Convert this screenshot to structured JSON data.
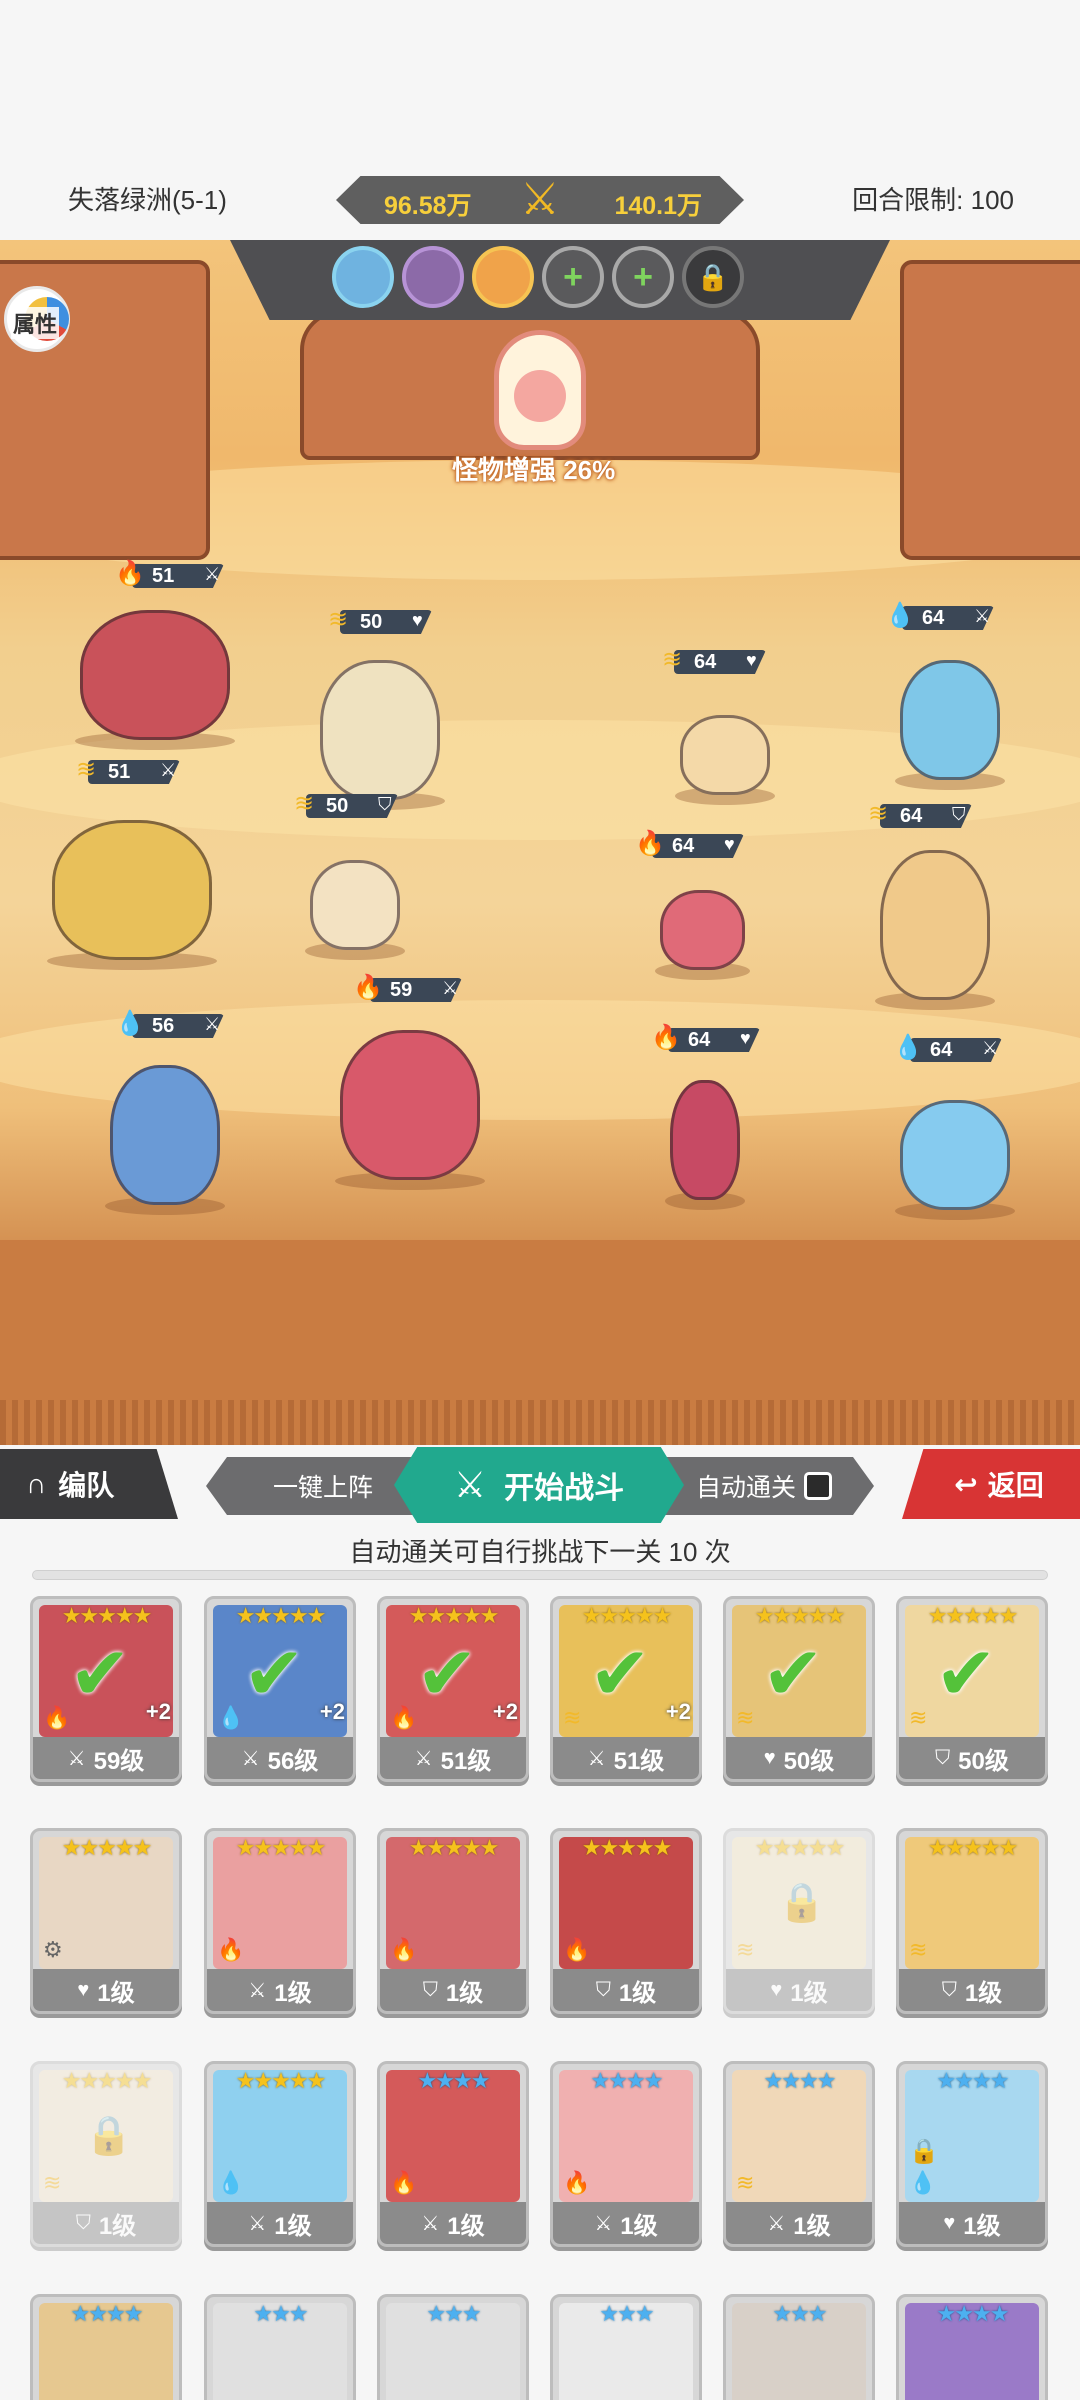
{
  "header": {
    "stage": "失落绿洲(5-1)",
    "power_left": "96.58万",
    "power_right": "140.1万",
    "round_limit": "回合限制: 100"
  },
  "battlefield": {
    "attribute_button": "属性",
    "boss_buff": "怪物增强 26%",
    "team_slots": [
      "hero",
      "hero",
      "hero",
      "add",
      "add",
      "lock"
    ],
    "units": [
      {
        "level": "51",
        "element": "fire",
        "class": "sword"
      },
      {
        "level": "51",
        "element": "wind",
        "class": "sword"
      },
      {
        "level": "50",
        "element": "wind",
        "class": "heart"
      },
      {
        "level": "50",
        "element": "wind",
        "class": "shield"
      },
      {
        "level": "56",
        "element": "water",
        "class": "sword"
      },
      {
        "level": "59",
        "element": "fire",
        "class": "sword"
      },
      {
        "level": "64",
        "element": "wind",
        "class": "heart"
      },
      {
        "level": "64",
        "element": "fire",
        "class": "heart"
      },
      {
        "level": "64",
        "element": "fire",
        "class": "heart"
      },
      {
        "level": "64",
        "element": "water",
        "class": "sword"
      },
      {
        "level": "64",
        "element": "wind",
        "class": "shield"
      },
      {
        "level": "64",
        "element": "water",
        "class": "sword"
      }
    ]
  },
  "actions": {
    "team": "编队",
    "one_key": "一键上阵",
    "start_battle": "开始战斗",
    "auto_clear": "自动通关",
    "back": "返回",
    "auto_hint": "自动通关可自行挑战下一关 10 次"
  },
  "heroes": [
    {
      "level": "59级",
      "stars": "★★★★★",
      "star_color": "gold",
      "element": "fire",
      "class": "sword",
      "selected": true,
      "plus": "+2",
      "art": "#c9525a"
    },
    {
      "level": "56级",
      "stars": "★★★★★",
      "star_color": "gold",
      "element": "water",
      "class": "sword",
      "selected": true,
      "plus": "+2",
      "art": "#5a86c9"
    },
    {
      "level": "51级",
      "stars": "★★★★★",
      "star_color": "gold",
      "element": "fire",
      "class": "sword",
      "selected": true,
      "plus": "+2",
      "art": "#d45a5a"
    },
    {
      "level": "51级",
      "stars": "★★★★★",
      "star_color": "gold",
      "element": "wind",
      "class": "sword",
      "selected": true,
      "plus": "+2",
      "art": "#e8c05a"
    },
    {
      "level": "50级",
      "stars": "★★★★★",
      "star_color": "gold",
      "element": "wind",
      "class": "heart",
      "selected": true,
      "plus": "",
      "art": "#e6c478"
    },
    {
      "level": "50级",
      "stars": "★★★★★",
      "star_color": "gold",
      "element": "wind",
      "class": "shield",
      "selected": true,
      "plus": "",
      "art": "#efd7a0"
    },
    {
      "level": "1级",
      "stars": "★★★★★",
      "star_color": "gold",
      "element": "gear",
      "class": "heart",
      "selected": false,
      "plus": "",
      "art": "#e8d7c4"
    },
    {
      "level": "1级",
      "stars": "★★★★★",
      "star_color": "gold",
      "element": "fire",
      "class": "sword",
      "selected": false,
      "plus": "",
      "art": "#eaa0a0"
    },
    {
      "level": "1级",
      "stars": "★★★★★",
      "star_color": "gold",
      "element": "fire",
      "class": "shield",
      "selected": false,
      "plus": "",
      "art": "#d4696c"
    },
    {
      "level": "1级",
      "stars": "★★★★★",
      "star_color": "gold",
      "element": "fire",
      "class": "shield",
      "selected": false,
      "plus": "",
      "art": "#c54a4a"
    },
    {
      "level": "1级",
      "stars": "★★★★★",
      "star_color": "gold",
      "element": "wind",
      "class": "heart",
      "selected": false,
      "plus": "",
      "art": "#efe0c0",
      "locked": true
    },
    {
      "level": "1级",
      "stars": "★★★★★",
      "star_color": "gold",
      "element": "wind",
      "class": "shield",
      "selected": false,
      "plus": "",
      "art": "#efc97a"
    },
    {
      "level": "1级",
      "stars": "★★★★★",
      "star_color": "gold",
      "element": "wind",
      "class": "shield",
      "selected": false,
      "plus": "",
      "art": "#efe0c8",
      "locked": true
    },
    {
      "level": "1级",
      "stars": "★★★★★",
      "star_color": "gold",
      "element": "water",
      "class": "sword",
      "selected": false,
      "plus": "",
      "art": "#8fd0ef"
    },
    {
      "level": "1级",
      "stars": "★★★★",
      "star_color": "blue",
      "element": "fire",
      "class": "sword",
      "selected": false,
      "plus": "",
      "art": "#d45a5a"
    },
    {
      "level": "1级",
      "stars": "★★★★",
      "star_color": "blue",
      "element": "fire",
      "class": "sword",
      "selected": false,
      "plus": "",
      "art": "#f0b0b0"
    },
    {
      "level": "1级",
      "stars": "★★★★",
      "star_color": "blue",
      "element": "wind",
      "class": "sword",
      "selected": false,
      "plus": "",
      "art": "#f0d8b8"
    },
    {
      "level": "1级",
      "stars": "★★★★",
      "star_color": "blue",
      "element": "water",
      "class": "heart",
      "selected": false,
      "plus": "",
      "art": "#a8d8f0",
      "small_lock": true
    },
    {
      "level": "",
      "stars": "★★★★",
      "star_color": "blue",
      "element": "",
      "class": "",
      "selected": false,
      "plus": "",
      "art": "#e6c890"
    },
    {
      "level": "",
      "stars": "★★★",
      "star_color": "blue",
      "element": "",
      "class": "",
      "selected": false,
      "plus": "",
      "art": "#e0e0e0"
    },
    {
      "level": "",
      "stars": "★★★",
      "star_color": "blue",
      "element": "",
      "class": "",
      "selected": false,
      "plus": "",
      "art": "#e0e0e0"
    },
    {
      "level": "",
      "stars": "★★★",
      "star_color": "blue",
      "element": "",
      "class": "",
      "selected": false,
      "plus": "",
      "art": "#eaeaea"
    },
    {
      "level": "",
      "stars": "★★★",
      "star_color": "blue",
      "element": "",
      "class": "",
      "selected": false,
      "plus": "",
      "art": "#d8d0c8"
    },
    {
      "level": "",
      "stars": "★★★★",
      "star_color": "blue",
      "element": "",
      "class": "",
      "selected": false,
      "plus": "",
      "art": "#9a7ac8"
    }
  ],
  "icons": {
    "fire": "🔥",
    "water": "💧",
    "wind": "≋",
    "gear": "⚙",
    "sword": "⚔",
    "heart": "♥",
    "shield": "⛉"
  }
}
